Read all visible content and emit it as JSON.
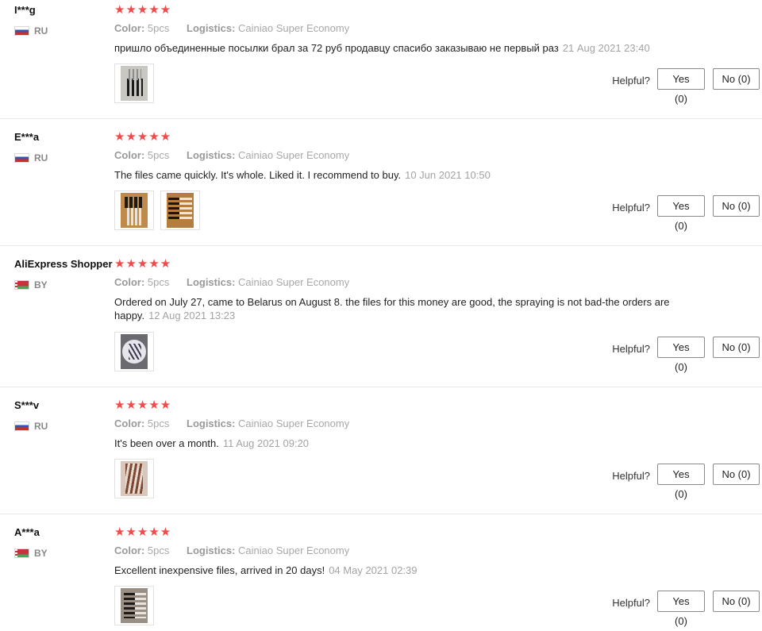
{
  "labels": {
    "color": "Color:",
    "logistics": "Logistics:",
    "helpful": "Helpful?",
    "stars": "★★★★★"
  },
  "reviews": [
    {
      "user": "I***g",
      "country": "RU",
      "rating": 5,
      "color": "5pcs",
      "logistics": "Cainiao Super Economy",
      "text": "пришло объединенные посылки брал за 72 руб продавцу спасибо заказываю не первый раз",
      "date": "21 Aug 2021 23:40",
      "yes": "Yes (0)",
      "no": "No (0)"
    },
    {
      "user": "E***a",
      "country": "RU",
      "rating": 5,
      "color": "5pcs",
      "logistics": "Cainiao Super Economy",
      "text": "The files came quickly. It's whole. Liked it. I recommend to buy.",
      "date": "10 Jun 2021 10:50",
      "yes": "Yes (0)",
      "no": "No (0)"
    },
    {
      "user": "AliExpress Shopper",
      "country": "BY",
      "rating": 5,
      "color": "5pcs",
      "logistics": "Cainiao Super Economy",
      "text": "Ordered on July 27, came to Belarus on August 8. the files for this money are good, the spraying is not bad-the orders are happy.",
      "date": "12 Aug 2021 13:23",
      "yes": "Yes (0)",
      "no": "No (0)"
    },
    {
      "user": "S***v",
      "country": "RU",
      "rating": 5,
      "color": "5pcs",
      "logistics": "Cainiao Super Economy",
      "text": "It's been over a month.",
      "date": "11 Aug 2021 09:20",
      "yes": "Yes (0)",
      "no": "No (0)"
    },
    {
      "user": "A***a",
      "country": "BY",
      "rating": 5,
      "color": "5pcs",
      "logistics": "Cainiao Super Economy",
      "text": "Excellent inexpensive files, arrived in 20 days!",
      "date": "04 May 2021 02:39",
      "yes": "Yes (0)",
      "no": "No (0)"
    }
  ],
  "colors": {
    "star": "#f04a4a",
    "muted_text": "#999999",
    "divider": "#e8e8e8"
  }
}
